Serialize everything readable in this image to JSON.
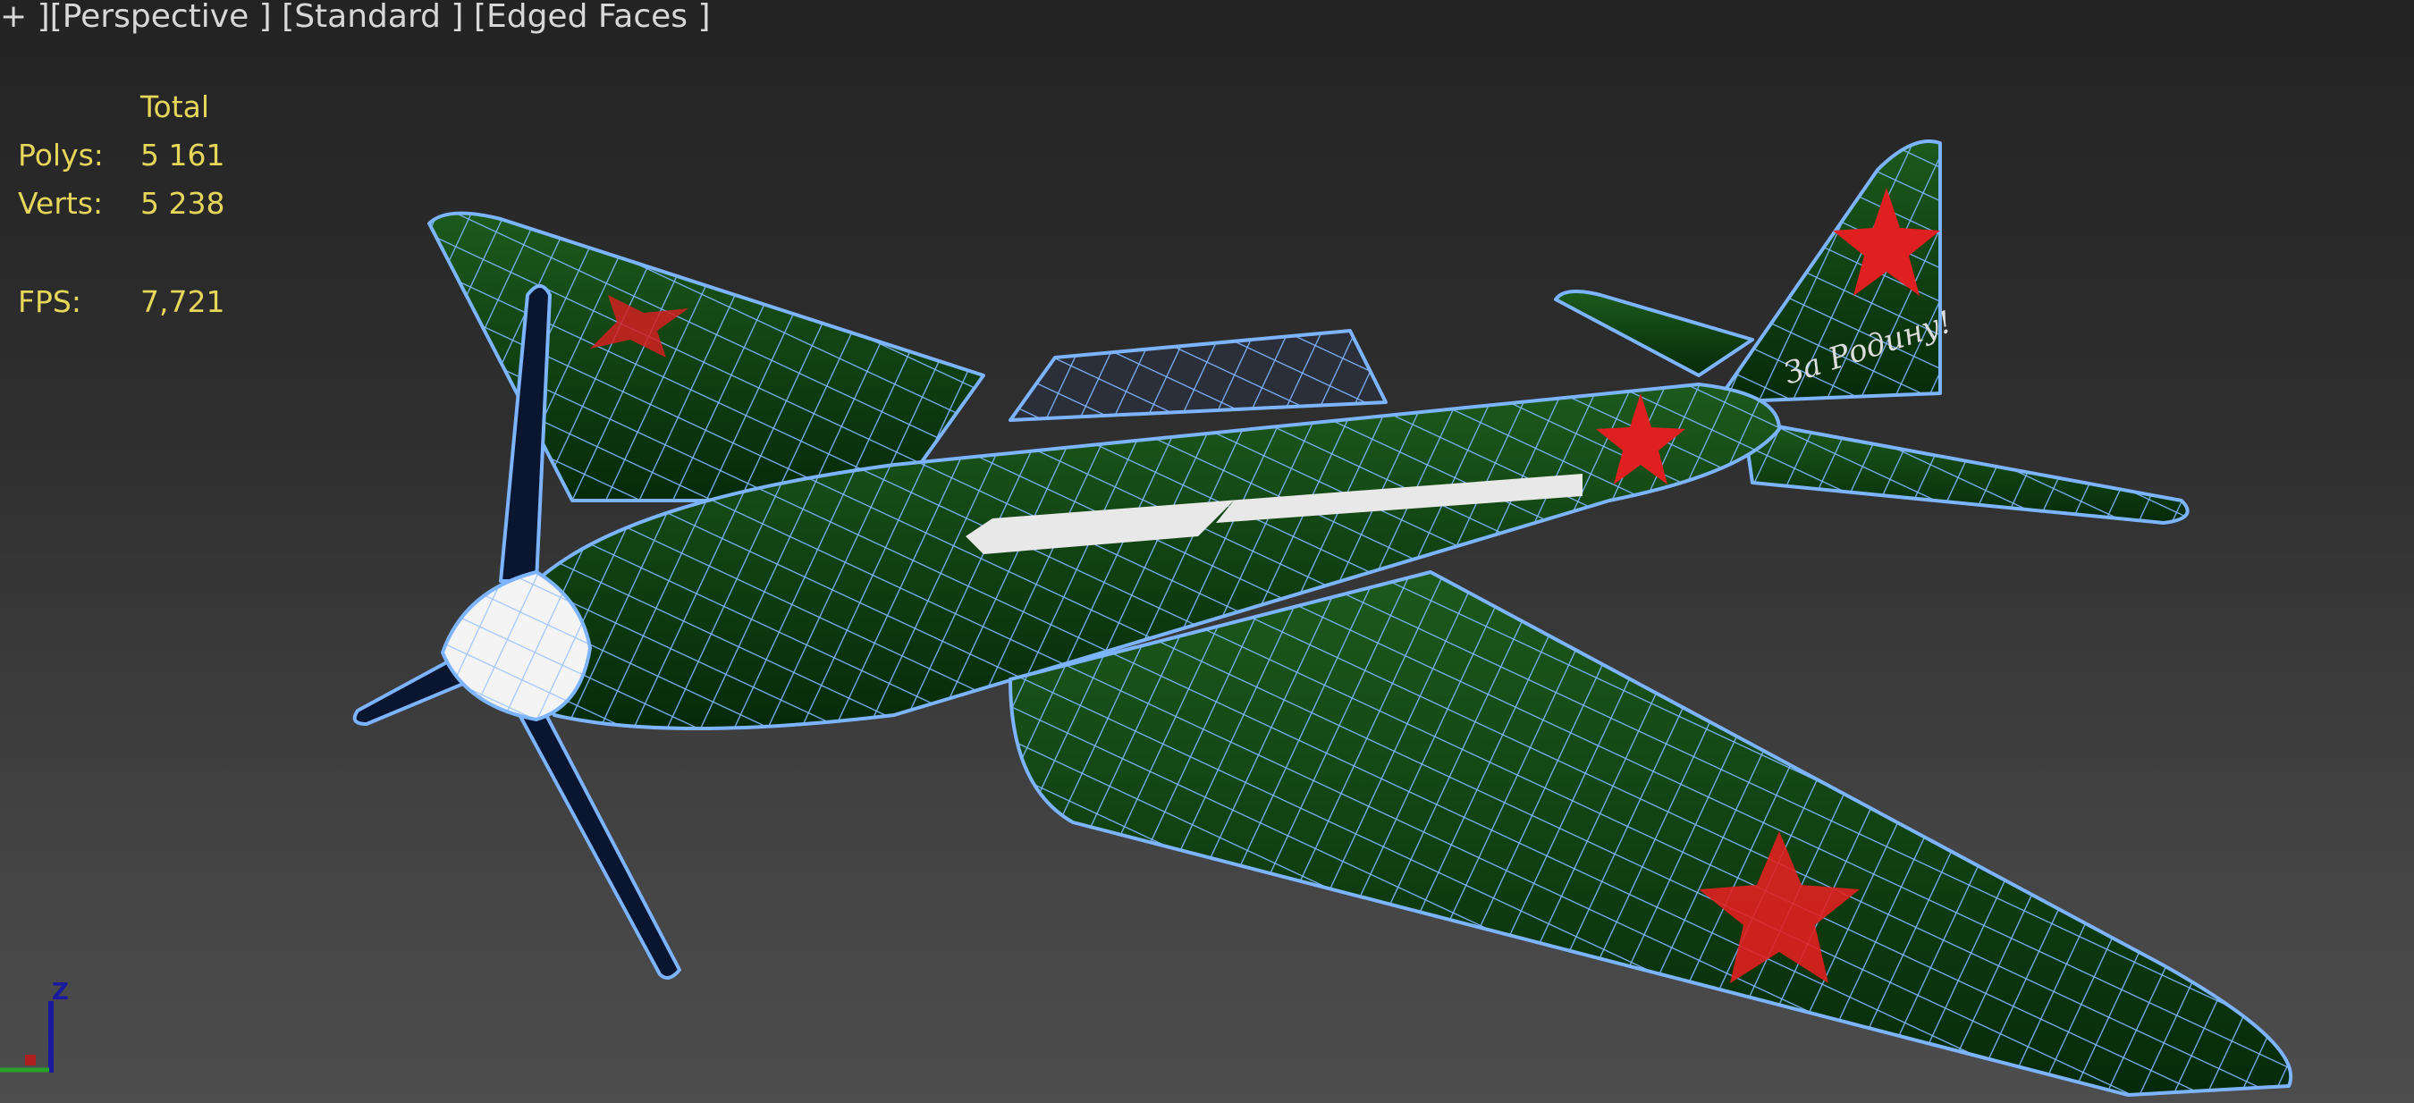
{
  "viewport": {
    "menu_label": "+",
    "view_label": "Perspective",
    "shading_label": "Standard",
    "display_label": "Edged Faces"
  },
  "stats": {
    "header": "Total",
    "polys_label": "Polys:",
    "polys_value": "5 161",
    "verts_label": "Verts:",
    "verts_value": "5 238",
    "fps_label": "FPS:",
    "fps_value": "7,721"
  },
  "gizmo": {
    "z_label": "Z"
  },
  "model": {
    "tail_text": "За Родину!"
  },
  "colors": {
    "wire": "#7db4ff",
    "body": "#0d3a10",
    "star": "#e02020",
    "stats": "#e6d65a"
  }
}
